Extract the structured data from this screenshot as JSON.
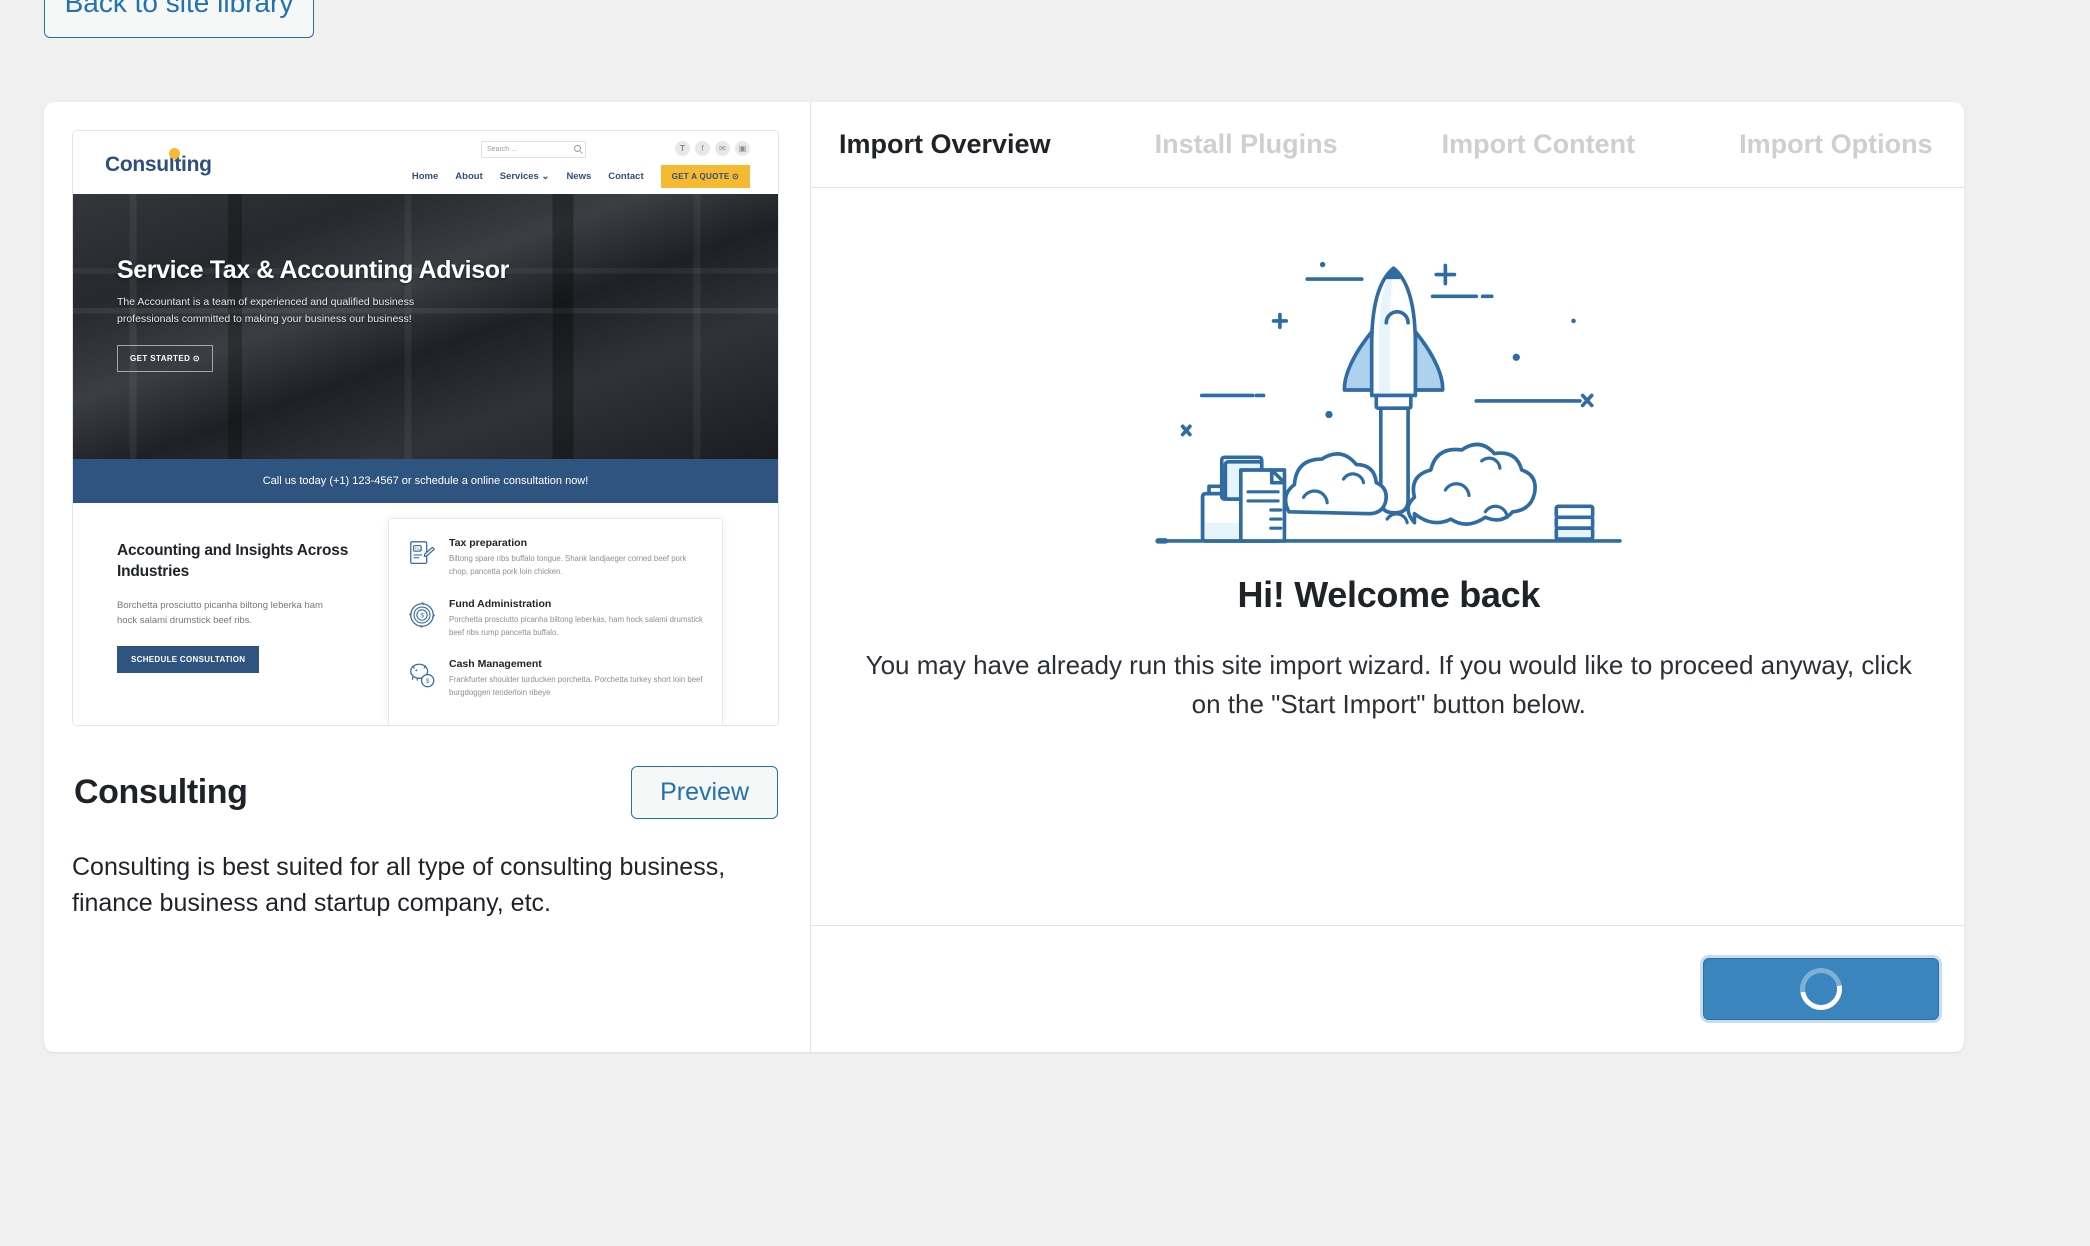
{
  "back_button": {
    "label": "Back to site library"
  },
  "site_card": {
    "title": "Consulting",
    "preview_label": "Preview",
    "description": "Consulting is best suited for all type of consulting business, finance business and startup company, etc.",
    "thumbnail": {
      "logo": "Consulting",
      "search_placeholder": "Search ...",
      "social": [
        "𝐓",
        "f",
        "✉",
        "▣"
      ],
      "nav": [
        "Home",
        "About",
        "Services ⌄",
        "News",
        "Contact"
      ],
      "quote_button": "GET A QUOTE ⊙",
      "hero_title": "Service Tax & Accounting Advisor",
      "hero_subtitle": "The Accountant is a team of experienced and qualified business professionals committed to making your business our business!",
      "hero_button": "GET STARTED ⊙",
      "call_bar": "Call us today (+1) 123-4567 or schedule a online consultation now!",
      "section_title": "Accounting and Insights Across Industries",
      "section_text": "Borchetta prosciutto picanha biltong leberka ham hock salami drumstick beef ribs.",
      "section_button": "SCHEDULE CONSULTATION",
      "services": [
        {
          "icon": "tax-document-icon",
          "title": "Tax preparation",
          "text": "Biltong spare ribs buffalo tongue. Shank landjaeger corned beef pork chop, pancetta pork loin chicken."
        },
        {
          "icon": "fund-coin-icon",
          "title": "Fund Administration",
          "text": "Porchetta prosciutto picanha biltong leberkas, ham hock salami drumstick beef ribs rump pancetta buffalo."
        },
        {
          "icon": "piggy-bank-icon",
          "title": "Cash Management",
          "text": "Frankfurter shoulder turducken porchetta. Porchetta turkey short loin beef burgdoggen tenderloin ribeye"
        }
      ]
    }
  },
  "wizard": {
    "tabs": [
      {
        "label": "Import Overview",
        "active": true
      },
      {
        "label": "Install Plugins",
        "active": false
      },
      {
        "label": "Import Content",
        "active": false
      },
      {
        "label": "Import Options",
        "active": false
      }
    ],
    "illustration": "rocket-launch-illustration",
    "heading": "Hi! Welcome back",
    "body": "You may have already run this site import wizard. If you would like to proceed anyway, click on the \"Start Import\" button below.",
    "start_button": {
      "label": "",
      "state": "loading",
      "spinner": "loading-spinner-icon"
    }
  },
  "colors": {
    "page_background": "#f0f0f1",
    "accent_blue": "#2271b1",
    "button_blue": "#3a85bd",
    "brand_navy": "#2f5480",
    "brand_yellow": "#f5b932",
    "illustration_stroke": "#2f6ca3",
    "illustration_fill": "#aed2ee"
  }
}
